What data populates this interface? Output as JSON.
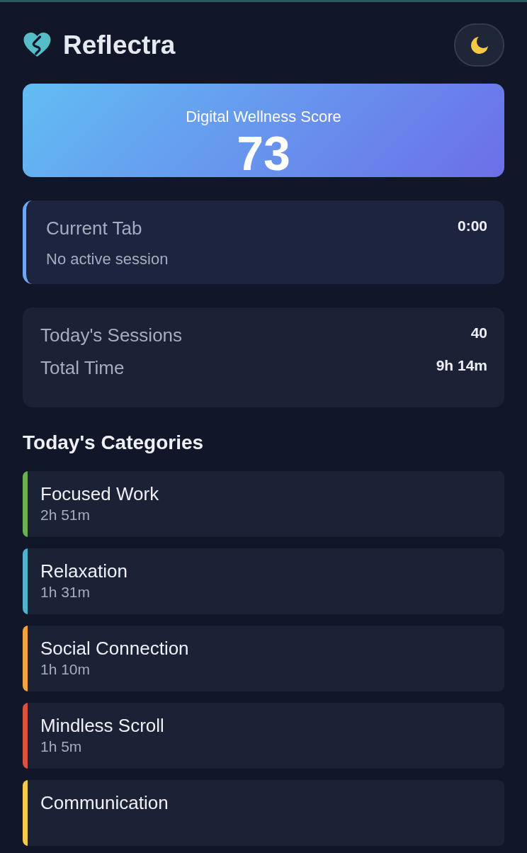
{
  "header": {
    "title": "Reflectra"
  },
  "score": {
    "label": "Digital Wellness Score",
    "value": "73"
  },
  "current_tab": {
    "label": "Current Tab",
    "time": "0:00",
    "status": "No active session"
  },
  "stats": [
    {
      "label": "Today's Sessions",
      "value": "40"
    },
    {
      "label": "Total Time",
      "value": "9h 14m"
    }
  ],
  "categories": {
    "title": "Today's Categories",
    "items": [
      {
        "name": "Focused Work",
        "time": "2h 51m",
        "color": "#6ab04c"
      },
      {
        "name": "Relaxation",
        "time": "1h 31m",
        "color": "#4fb3d0"
      },
      {
        "name": "Social Connection",
        "time": "1h 10m",
        "color": "#f5a33b"
      },
      {
        "name": "Mindless Scroll",
        "time": "1h 5m",
        "color": "#e0503f"
      },
      {
        "name": "Communication",
        "color": "#f7cb45"
      }
    ]
  }
}
